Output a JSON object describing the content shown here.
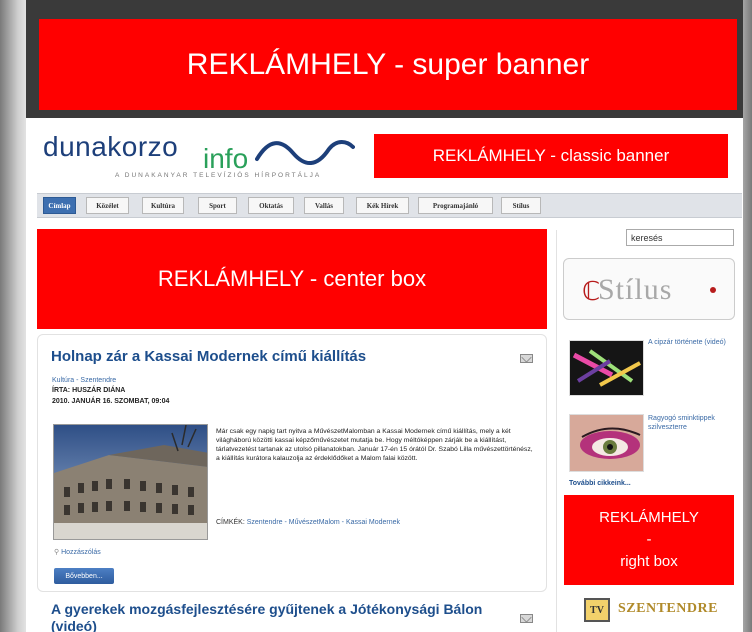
{
  "banners": {
    "super": "REKLÁMHELY - super banner",
    "classic": "REKLÁMHELY - classic banner",
    "center": "REKLÁMHELY - center box",
    "right_line1": "REKLÁMHELY",
    "right_line2": "-",
    "right_line3": "right box"
  },
  "logo": {
    "main": "dunakorzo",
    "info": "info",
    "tagline": "A DUNAKANYAR TELEVÍZIÓS HÍRPORTÁLJA"
  },
  "nav": {
    "items": [
      "Címlap",
      "Közélet",
      "Kultúra",
      "Sport",
      "Oktatás",
      "Vallás",
      "Kék Hírek",
      "Programajánló",
      "Stílus"
    ],
    "active": "Címlap"
  },
  "search": {
    "value": "keresés"
  },
  "sidebar": {
    "stilus_logo": "Stílus",
    "items": [
      {
        "label": "A cipzár története (videó)"
      },
      {
        "label": "Ragyogó sminktippek szilveszterre"
      }
    ],
    "more_label": "További cikkeink...",
    "tv_label": "SZENTENDRE",
    "tv_logo": "TV"
  },
  "article": {
    "title": "Holnap zár a Kassai Modernek című kiállítás",
    "category": "Kultúra - Szentendre",
    "author": "ÍRTA: HUSZÁR DIÁNA",
    "date": "2010. JANUÁR 16. SZOMBAT, 09:04",
    "body": "Már csak egy napig tart nyitva a MűvészetMalomban a Kassai Modernek című kiállítás, mely a két világháború közötti kassai képzőművészetet mutatja be. Hogy méltóképpen zárják be a kiállítást, tárlatvezetést tartanak az utolsó pillanatokban. Január 17-én 15 órától Dr. Szabó Lilla művészettörténész, a kiállítás kurátora kalauzolja az érdeklődőket a Malom falai között.",
    "tags_label": "CÍMKÉK:",
    "tags": "Szentendre - MűvészetMalom - Kassai Modernek",
    "comments": "Hozzászólás",
    "more_button": "Bővebben..."
  },
  "article2": {
    "title": "A gyerekek mozgásfejlesztésére gyűjtenek a Jótékonysági Bálon (videó)"
  },
  "colors": {
    "ad_red": "#ff0000",
    "link_blue": "#1d4e8c",
    "nav_active": "#3d6fb0"
  }
}
